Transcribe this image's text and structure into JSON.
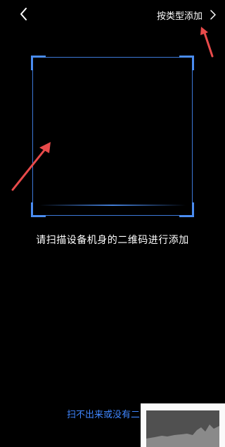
{
  "header": {
    "back_icon": "chevron-left-icon",
    "type_add_label": "按类型添加",
    "type_add_icon": "chevron-right-icon"
  },
  "scanner": {
    "accent_color": "#4a8cf0",
    "hint_text": "请扫描设备机身的二维码进行添加"
  },
  "footer": {
    "link_text": "扫不出来或没有二",
    "link_color": "#3f86ff"
  },
  "annotations": {
    "arrow_color": "#e84a4a"
  }
}
